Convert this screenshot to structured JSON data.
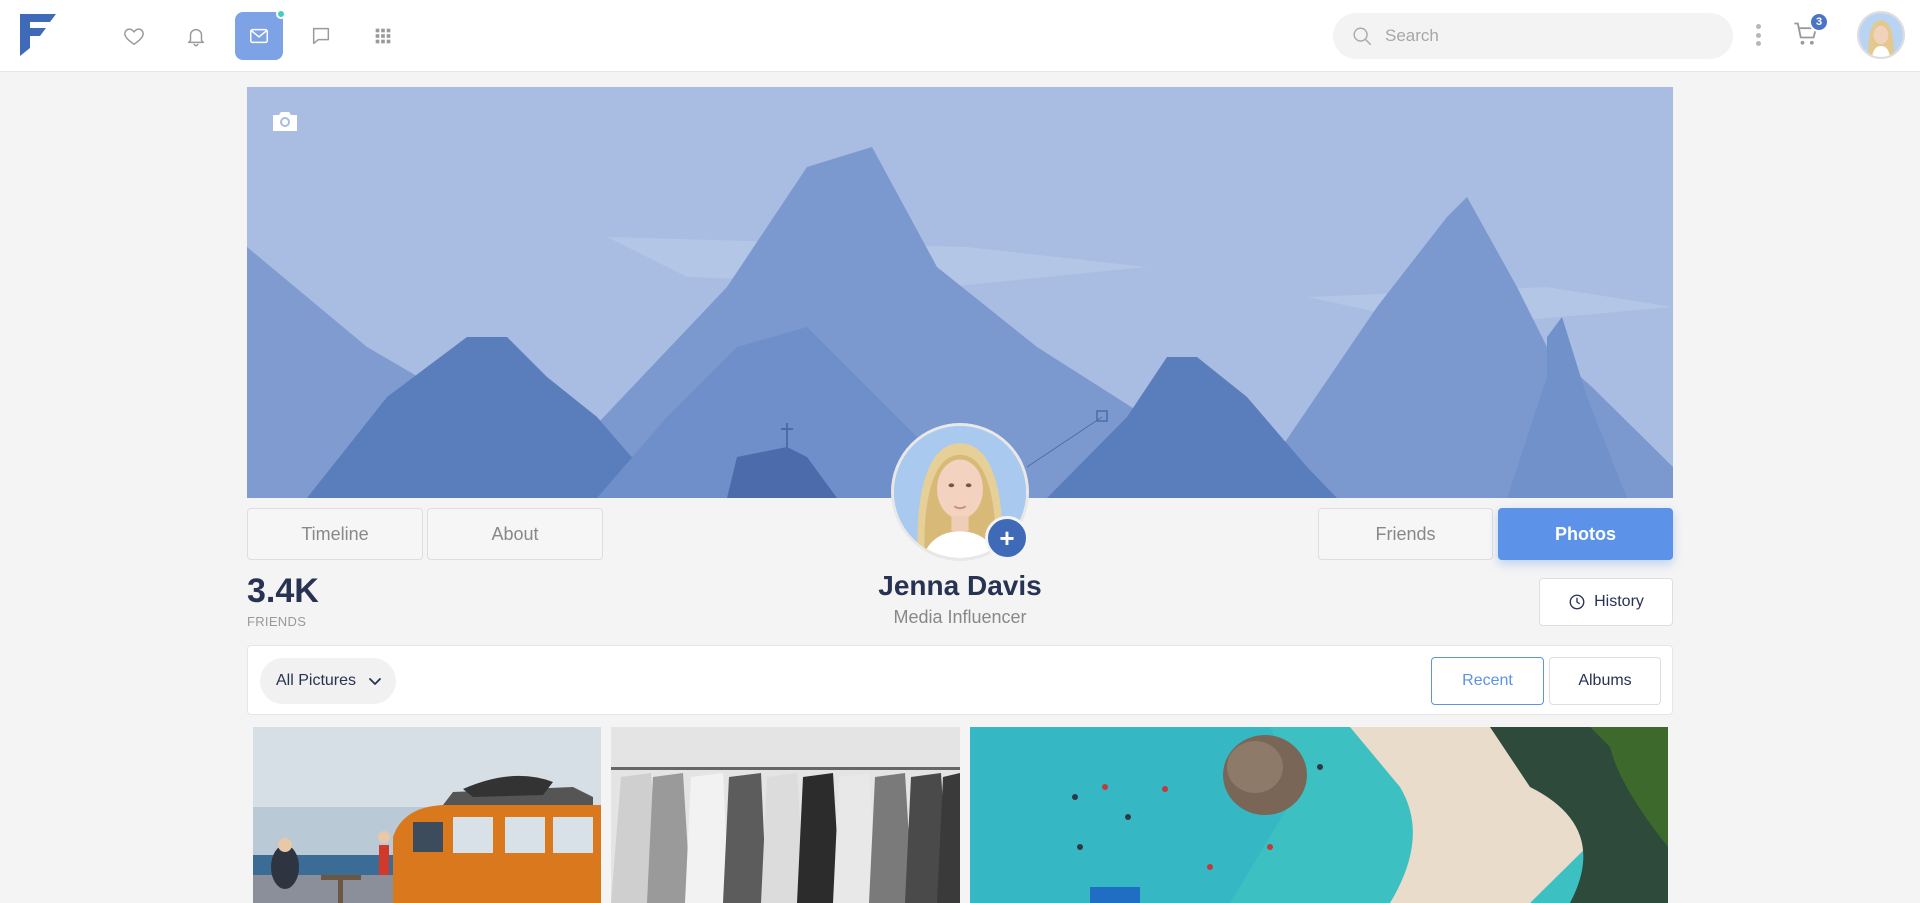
{
  "topnav": {
    "search_placeholder": "Search",
    "cart_count": "3",
    "icons": [
      "heart-icon",
      "bell-icon",
      "mail-icon",
      "chat-icon",
      "grid-icon"
    ],
    "active_icon": "mail-icon"
  },
  "profile": {
    "name": "Jenna Davis",
    "title": "Media Influencer",
    "friends_count": "3.4K",
    "friends_label": "FRIENDS",
    "add_symbol": "+"
  },
  "tabs": {
    "timeline": "Timeline",
    "about": "About",
    "friends": "Friends",
    "photos": "Photos",
    "active": "Photos"
  },
  "history_label": "History",
  "filter": {
    "dropdown_label": "All Pictures",
    "recent": "Recent",
    "albums": "Albums",
    "active": "Recent"
  },
  "colors": {
    "primary": "#5c92e8",
    "accent_dot": "#3fd0bd",
    "badge": "#4a74c8",
    "cover_sky": "#a9bce1"
  }
}
